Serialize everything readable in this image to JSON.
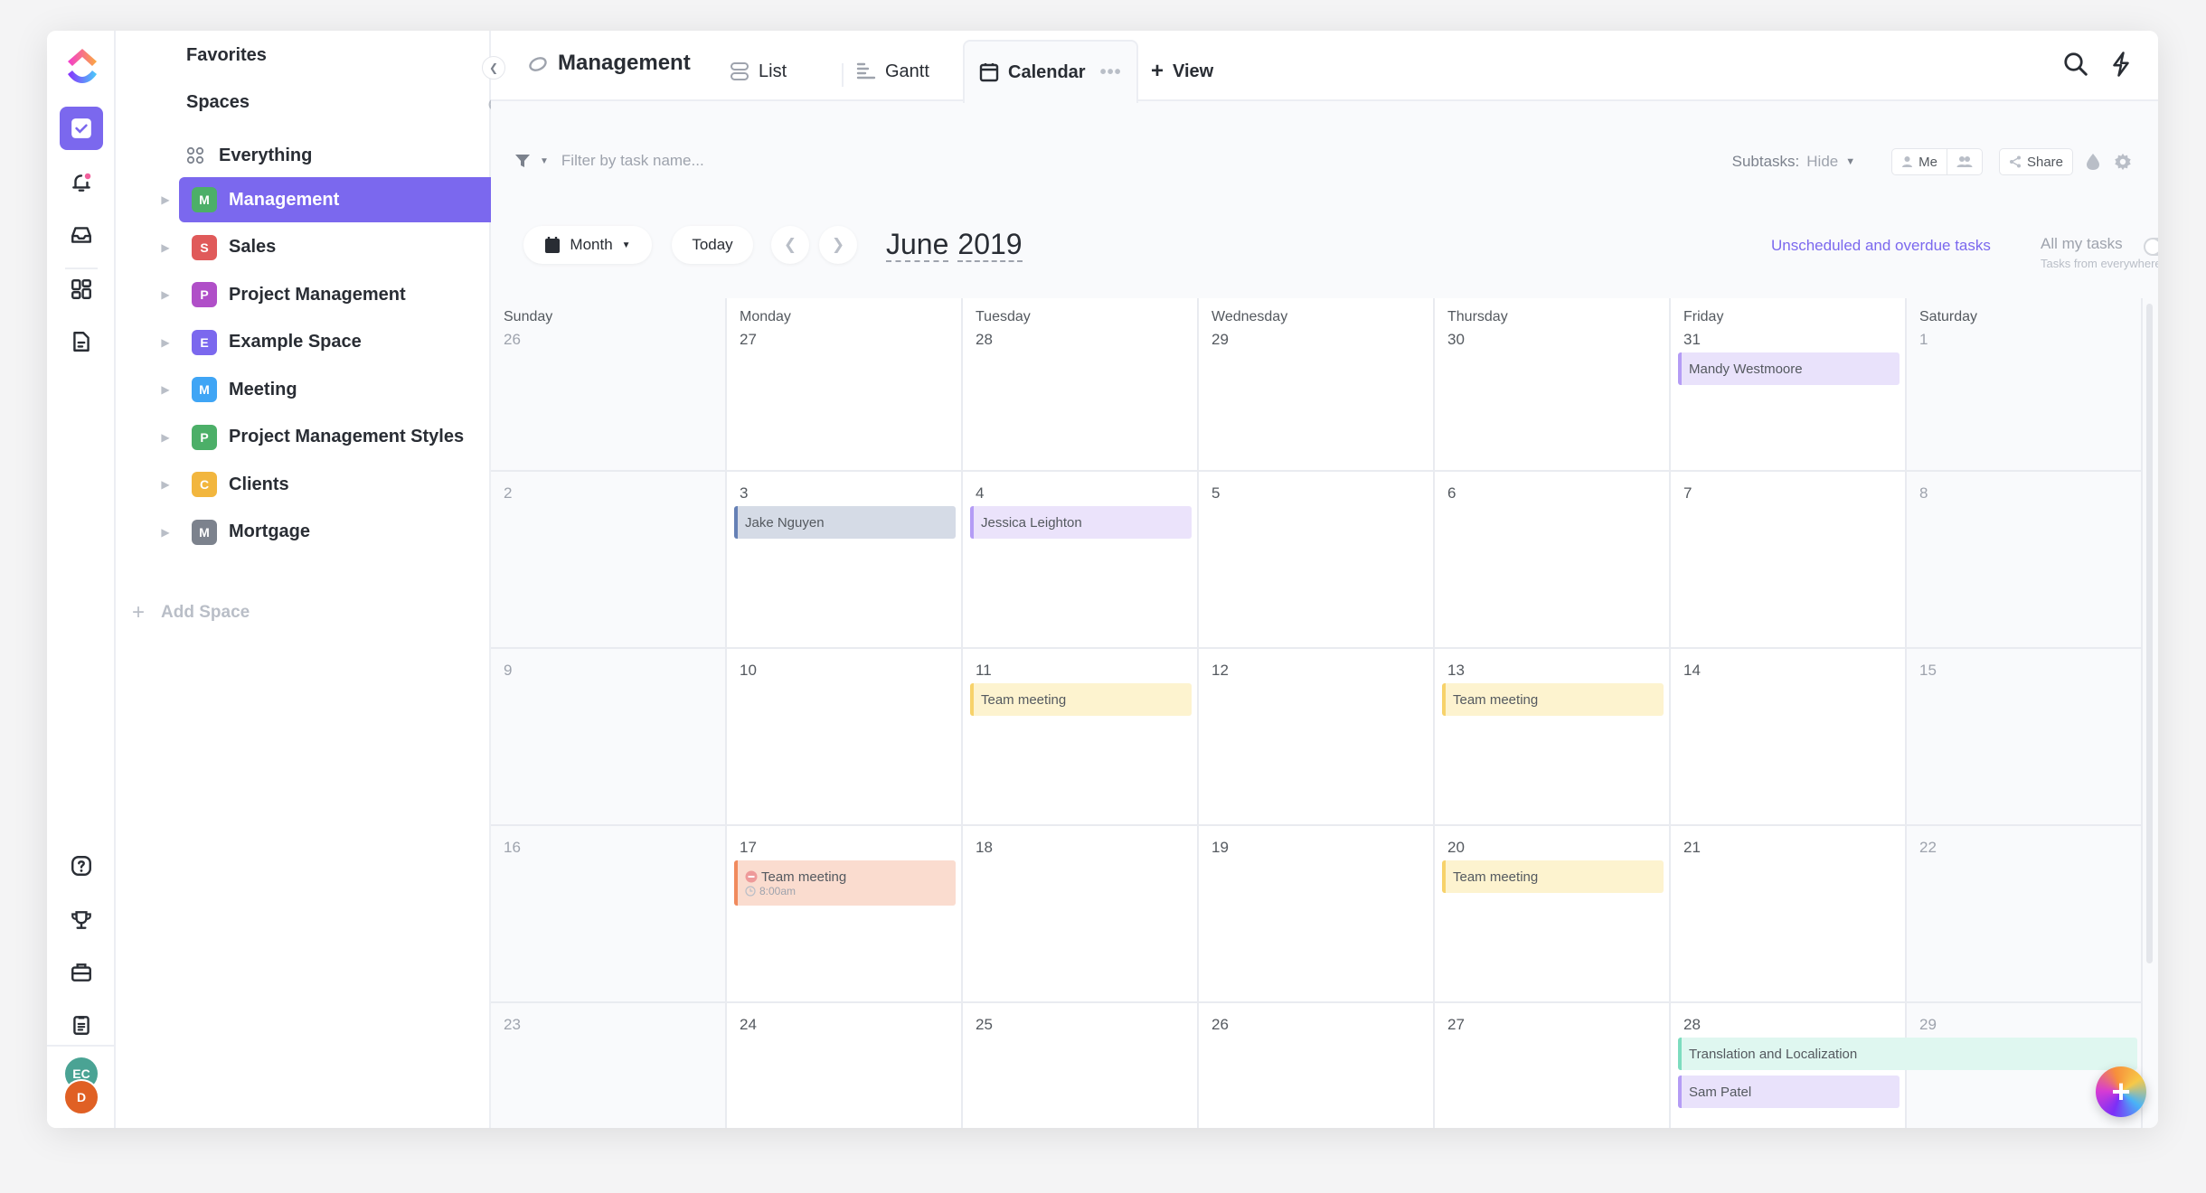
{
  "rail": {
    "icons": [
      "tasks-icon",
      "notifications-icon",
      "inbox-icon",
      "dashboards-icon",
      "docs-icon",
      "help-icon",
      "goals-icon",
      "portfolio-icon",
      "clipboard-icon"
    ],
    "avatars": [
      {
        "initials": "EC",
        "color": "#4aa394"
      },
      {
        "initials": "D",
        "color": "#e06024"
      }
    ]
  },
  "sidebar": {
    "favorites_label": "Favorites",
    "spaces_label": "Spaces",
    "everything_label": "Everything",
    "add_space_label": "Add Space",
    "spaces": [
      {
        "letter": "M",
        "label": "Management",
        "color": "#4caf68",
        "active": true
      },
      {
        "letter": "S",
        "label": "Sales",
        "color": "#e05a5a"
      },
      {
        "letter": "P",
        "label": "Project Management",
        "color": "#b04fc8"
      },
      {
        "letter": "E",
        "label": "Example Space",
        "color": "#7b68ee"
      },
      {
        "letter": "M",
        "label": "Meeting",
        "color": "#3fa5f5"
      },
      {
        "letter": "P",
        "label": "Project Management Styles",
        "color": "#4caf68"
      },
      {
        "letter": "C",
        "label": "Clients",
        "color": "#f2b63e"
      },
      {
        "letter": "M",
        "label": "Mortgage",
        "color": "#7c828d"
      }
    ]
  },
  "header": {
    "title": "Management",
    "tabs": [
      {
        "label": "List",
        "icon": "list-icon"
      },
      {
        "label": "Gantt",
        "icon": "gantt-icon"
      },
      {
        "label": "Calendar",
        "icon": "calendar-icon",
        "active": true
      },
      {
        "label": "View",
        "icon": "plus-icon"
      }
    ]
  },
  "toolbar": {
    "filter_placeholder": "Filter by task name...",
    "subtasks_label": "Subtasks:",
    "subtasks_value": "Hide",
    "me_label": "Me",
    "share_label": "Share"
  },
  "calendar": {
    "view_mode": "Month",
    "today_label": "Today",
    "month": "June",
    "year": "2019",
    "unscheduled_label": "Unscheduled and overdue tasks",
    "all_my_tasks_label": "All my tasks",
    "all_my_tasks_sub": "Tasks from everywhere",
    "all_my_tasks_on": false,
    "weekdays": [
      "Sunday",
      "Monday",
      "Tuesday",
      "Wednesday",
      "Thursday",
      "Friday",
      "Saturday"
    ],
    "weeks": [
      [
        "26",
        "27",
        "28",
        "29",
        "30",
        "31",
        "1"
      ],
      [
        "2",
        "3",
        "4",
        "5",
        "6",
        "7",
        "8"
      ],
      [
        "9",
        "10",
        "11",
        "12",
        "13",
        "14",
        "15"
      ],
      [
        "16",
        "17",
        "18",
        "19",
        "20",
        "21",
        "22"
      ],
      [
        "23",
        "24",
        "25",
        "26",
        "27",
        "28",
        "29"
      ]
    ],
    "events": [
      {
        "title": "Mandy Westmoore",
        "week": 0,
        "day": 5,
        "span": 1,
        "slot": 0,
        "bg": "#e9e2fb",
        "border": "#b49cf5"
      },
      {
        "title": "Jake Nguyen",
        "week": 1,
        "day": 1,
        "span": 1,
        "slot": 0,
        "bg": "#d5dbe6",
        "border": "#6580b5"
      },
      {
        "title": "Jessica Leighton",
        "week": 1,
        "day": 2,
        "span": 1,
        "slot": 0,
        "bg": "#ebe3fb",
        "border": "#b49cf5"
      },
      {
        "title": "Team meeting",
        "week": 2,
        "day": 2,
        "span": 1,
        "slot": 0,
        "bg": "#fdf3cf",
        "border": "#f7d26a"
      },
      {
        "title": "Team meeting",
        "week": 2,
        "day": 4,
        "span": 1,
        "slot": 0,
        "bg": "#fdf3cf",
        "border": "#f7d26a"
      },
      {
        "title": "Team meeting",
        "week": 3,
        "day": 1,
        "span": 1,
        "slot": 0,
        "bg": "#fadccf",
        "border": "#f08a5d",
        "time": "8:00am",
        "status_icon": "blocked-icon"
      },
      {
        "title": "Team meeting",
        "week": 3,
        "day": 4,
        "span": 1,
        "slot": 0,
        "bg": "#fdf3cf",
        "border": "#f7d26a"
      },
      {
        "title": "Translation and Localization",
        "week": 4,
        "day": 5,
        "span": 2,
        "slot": 0,
        "bg": "#dff7f0",
        "border": "#7ddcbf"
      },
      {
        "title": "Sam Patel",
        "week": 4,
        "day": 5,
        "span": 1,
        "slot": 1,
        "bg": "#e9e2fb",
        "border": "#b49cf5"
      }
    ]
  }
}
